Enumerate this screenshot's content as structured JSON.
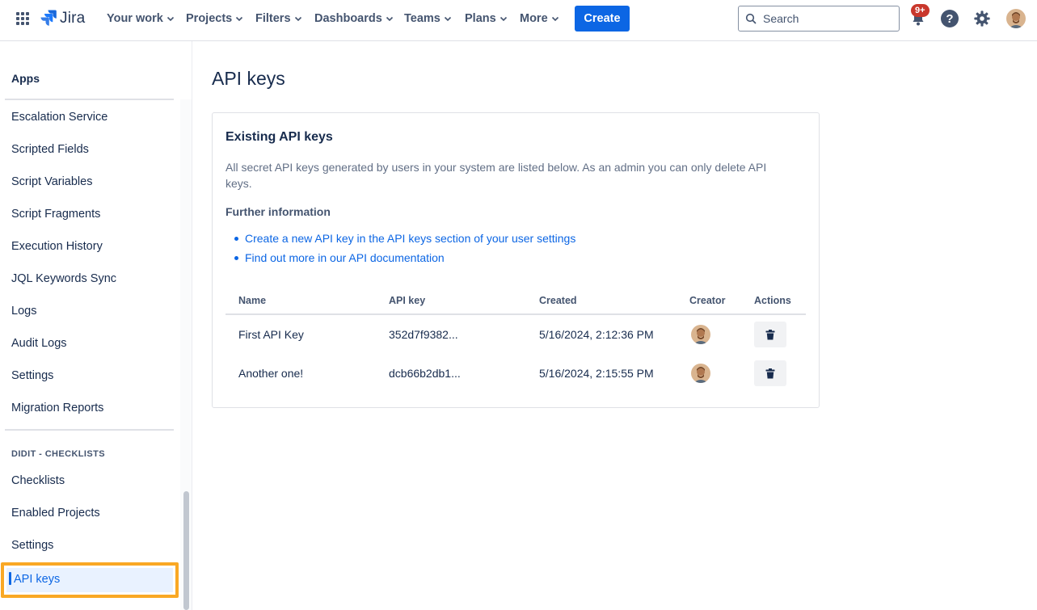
{
  "nav": {
    "logo_text": "Jira",
    "items": [
      "Your work",
      "Projects",
      "Filters",
      "Dashboards",
      "Teams",
      "Plans",
      "More"
    ],
    "create_label": "Create",
    "search_placeholder": "Search",
    "notification_badge": "9+",
    "help_glyph": "?"
  },
  "sidebar": {
    "heading": "Apps",
    "items": [
      "Escalation Service",
      "Scripted Fields",
      "Script Variables",
      "Script Fragments",
      "Execution History",
      "JQL Keywords Sync",
      "Logs",
      "Audit Logs",
      "Settings",
      "Migration Reports"
    ],
    "section_title": "DIDIT - CHECKLISTS",
    "section_items": [
      "Checklists",
      "Enabled Projects",
      "Settings"
    ],
    "active_item": "API keys"
  },
  "main": {
    "title": "API keys",
    "card": {
      "title": "Existing API keys",
      "description": "All secret API keys generated by users in your system are listed below. As an admin you can only delete API keys.",
      "further_heading": "Further information",
      "links": [
        "Create a new API key in the API keys section of your user settings",
        "Find out more in our API documentation"
      ],
      "table": {
        "headers": [
          "Name",
          "API key",
          "Created",
          "Creator",
          "Actions"
        ],
        "rows": [
          {
            "name": "First API Key",
            "key": "352d7f9382...",
            "created": "5/16/2024, 2:12:36 PM"
          },
          {
            "name": "Another one!",
            "key": "dcb66b2db1...",
            "created": "5/16/2024, 2:15:55 PM"
          }
        ]
      }
    }
  },
  "colors": {
    "primary": "#0c66e4",
    "highlight_border": "#f9a825",
    "badge_red": "#c9372c",
    "text": "#172b4d",
    "subtle_text": "#44546f"
  },
  "icons": [
    "app-grid-icon",
    "jira-logo-icon",
    "chevron-down-icon",
    "search-icon",
    "bell-icon",
    "help-icon",
    "gear-icon",
    "avatar",
    "trash-icon"
  ]
}
